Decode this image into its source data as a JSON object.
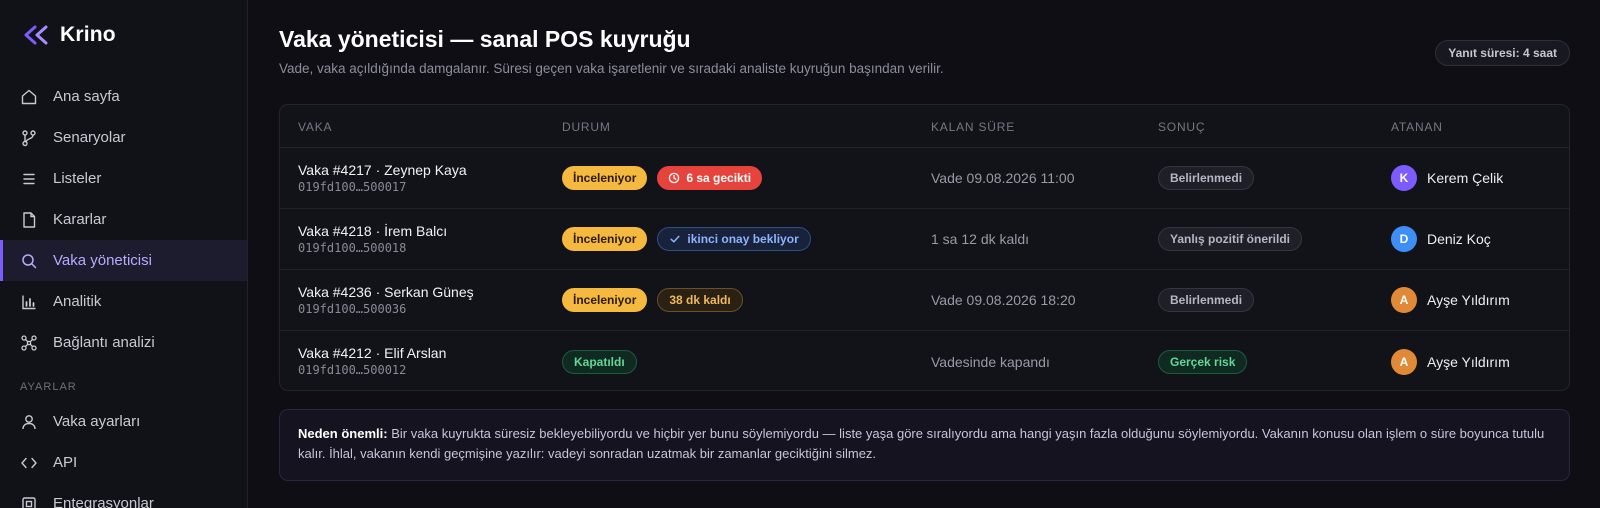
{
  "brand": {
    "name": "Krino",
    "accent": "#7c5cff"
  },
  "sidebar": {
    "items": [
      {
        "label": "Ana sayfa",
        "icon": "home-icon"
      },
      {
        "label": "Senaryolar",
        "icon": "branch-icon"
      },
      {
        "label": "Listeler",
        "icon": "list-icon"
      },
      {
        "label": "Kararlar",
        "icon": "document-icon"
      },
      {
        "label": "Vaka yöneticisi",
        "icon": "search-icon",
        "active": true
      },
      {
        "label": "Analitik",
        "icon": "bar-chart-icon"
      },
      {
        "label": "Bağlantı analizi",
        "icon": "graph-icon"
      }
    ],
    "section_label": "AYARLAR",
    "settings_items": [
      {
        "label": "Vaka ayarları",
        "icon": "user-icon"
      },
      {
        "label": "API",
        "icon": "code-icon"
      },
      {
        "label": "Entegrasyonlar",
        "icon": "plug-icon"
      }
    ]
  },
  "header": {
    "title": "Vaka yöneticisi — sanal POS kuyruğu",
    "subtitle": "Vade, vaka açıldığında damgalanır. Süresi geçen vaka işaretlenir ve sıradaki analiste kuyruğun başından verilir.",
    "response_time": "Yanıt süresi: 4 saat"
  },
  "table": {
    "columns": [
      "VAKA",
      "DURUM",
      "KALAN SÜRE",
      "SONUÇ",
      "ATANAN"
    ],
    "rows": [
      {
        "title": "Vaka #4217 · Zeynep Kaya",
        "id": "019fd100…500017",
        "status": "İnceleniyor",
        "flag": "6 sa gecikti",
        "remaining": "Vade 09.08.2026 11:00",
        "result": "Belirlenmedi",
        "assignee_initial": "K",
        "assignee": "Kerem Çelik"
      },
      {
        "title": "Vaka #4218 · İrem Balcı",
        "id": "019fd100…500018",
        "status": "İnceleniyor",
        "flag": "ikinci onay bekliyor",
        "remaining": "1 sa 12 dk kaldı",
        "result": "Yanlış pozitif önerildi",
        "assignee_initial": "D",
        "assignee": "Deniz Koç"
      },
      {
        "title": "Vaka #4236 · Serkan Güneş",
        "id": "019fd100…500036",
        "status": "İnceleniyor",
        "flag": "38 dk kaldı",
        "remaining": "Vade 09.08.2026 18:20",
        "result": "Belirlenmedi",
        "assignee_initial": "A",
        "assignee": "Ayşe Yıldırım"
      },
      {
        "title": "Vaka #4212 · Elif Arslan",
        "id": "019fd100…500012",
        "status": "Kapatıldı",
        "remaining": "Vadesinde kapandı",
        "result": "Gerçek risk",
        "assignee_initial": "A",
        "assignee": "Ayşe Yıldırım"
      }
    ]
  },
  "note": {
    "lead": "Neden önemli:",
    "text": "Bir vaka kuyrukta süresiz bekleyebiliyordu ve hiçbir yer bunu söylemiyordu — liste yaşa göre sıralıyordu ama hangi yaşın fazla olduğunu söylemiyordu. Vakanın konusu olan işlem o süre boyunca tutulu kalır. İhlal, vakanın kendi geçmişine yazılır: vadeyi sonradan uzatmak bir zamanlar geciktiğini silmez."
  },
  "colors": {
    "review": "#f5b940",
    "late": "#e6433d",
    "wait": "#8fb2ff",
    "soon": "#f0b85a",
    "closed": "#63d69a",
    "avatar_k": "#7c5cff",
    "avatar_d": "#3d8ef5",
    "avatar_a": "#e08a38"
  }
}
